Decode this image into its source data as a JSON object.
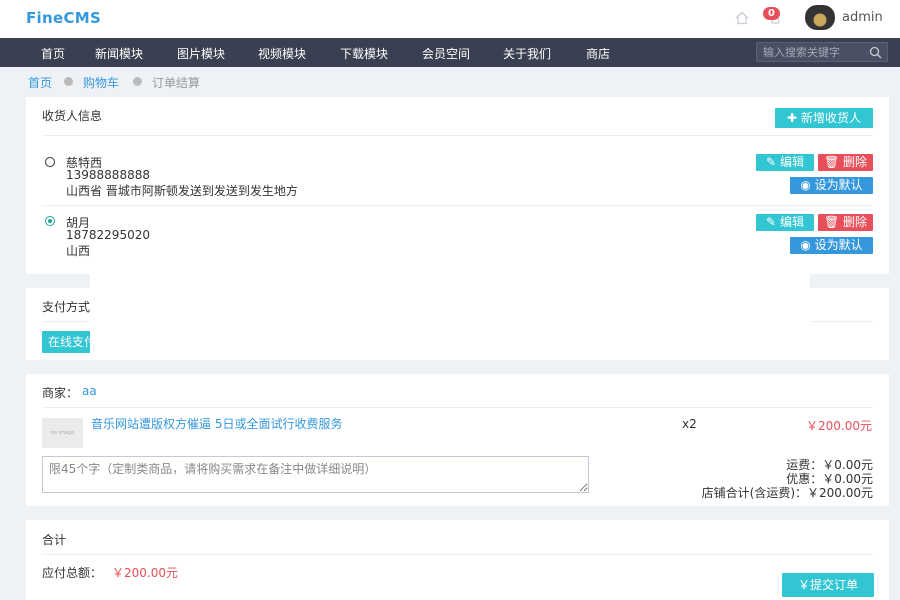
{
  "header": {
    "logo": "FineCMS",
    "notifications_count": "0",
    "username": "admin"
  },
  "nav": {
    "items": [
      "首页",
      "新闻模块",
      "图片模块",
      "视频模块",
      "下载模块",
      "会员空间",
      "关于我们",
      "商店"
    ],
    "search_placeholder": "输入搜索关键字"
  },
  "breadcrumb": [
    "首页",
    "购物车",
    "订单结算"
  ],
  "consignee": {
    "title": "收货人信息",
    "add_button": "新增收货人",
    "addresses": [
      {
        "name": "慈特西",
        "phone": "13988888888",
        "address": "山西省 晋城市阿斯顿发送到发送到发生地方",
        "selected": false,
        "edit": "编辑",
        "delete": "删除",
        "set_default": "设为默认"
      },
      {
        "name": "胡月",
        "phone": "18782295020",
        "address": "山西",
        "selected": true,
        "edit": "编辑",
        "delete": "删除",
        "set_default": "设为默认"
      }
    ]
  },
  "payment": {
    "title": "支付方式",
    "option": "在线支付"
  },
  "merchant": {
    "label": "商家：",
    "name": "aa",
    "thumb_text": "no image",
    "product": "音乐网站遭版权方催逼 5日或全面试行收费服务",
    "quantity": "x2",
    "price": "￥200.00元",
    "note_placeholder": "限45个字（定制类商品，请将购买需求在备注中做详细说明）",
    "shipping": "运费：￥0.00元",
    "discount": "优惠：￥0.00元",
    "store_total": "店铺合计(含运费)：￥200.00元"
  },
  "total": {
    "title": "合计",
    "label": "应付总额：",
    "amount": "￥200.00元",
    "submit": "￥提交订单"
  },
  "colors": {
    "nav_bg": "#3a3f51",
    "accent_cyan": "#32c5d2",
    "accent_red": "#e7505a",
    "accent_blue": "#3598dc"
  }
}
